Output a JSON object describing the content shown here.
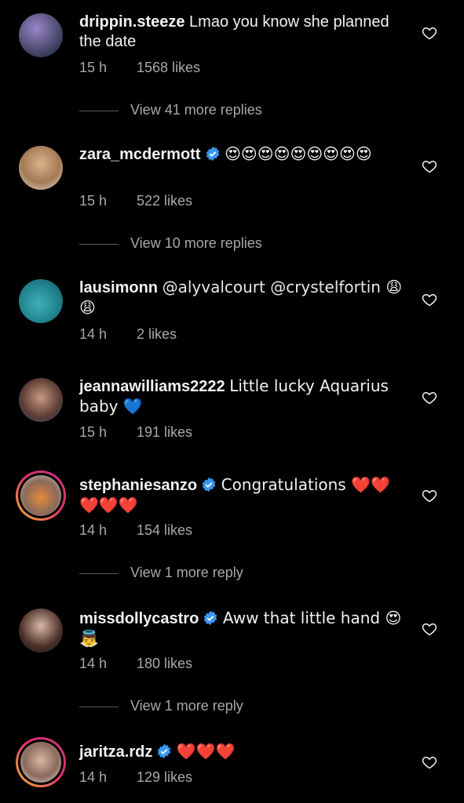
{
  "comments": [
    {
      "username": "drippin.steeze",
      "text": "Lmao you know she planned the date",
      "time": "15 h",
      "likes": "1568 likes",
      "verified": false,
      "replies_label": "View 41 more replies"
    },
    {
      "username": "zara_mcdermott",
      "text": "😍😍😍😍😍😍😍😍😍",
      "time": "15 h",
      "likes": "522 likes",
      "verified": true,
      "replies_label": "View 10 more replies"
    },
    {
      "username": "lausimonn",
      "text": "@alyvalcourt  @crystelfortin 😩😩",
      "time": "14 h",
      "likes": "2 likes",
      "verified": false
    },
    {
      "username": "jeannawilliams2222",
      "text": "Little lucky Aquarius baby 💙",
      "time": "15 h",
      "likes": "191 likes",
      "verified": false
    },
    {
      "username": "stephaniesanzo",
      "text": "Congratulations ❤️❤️❤️❤️❤️",
      "time": "14 h",
      "likes": "154 likes",
      "verified": true,
      "replies_label": "View 1 more reply"
    },
    {
      "username": "missdollycastro",
      "text": "Aww that little hand 😍👼",
      "time": "14 h",
      "likes": "180 likes",
      "verified": true,
      "replies_label": "View 1 more reply"
    },
    {
      "username": "jaritza.rdz",
      "text": "❤️❤️❤️",
      "time": "14 h",
      "likes": "129 likes",
      "verified": true
    }
  ],
  "colors": {
    "background": "#000000",
    "verified_blue": "#3897f0",
    "heart_red": "#ed4956",
    "meta_gray": "#a8a8a8"
  },
  "icons": {
    "like": "heart-outline-icon",
    "verified": "verified-badge-icon"
  }
}
